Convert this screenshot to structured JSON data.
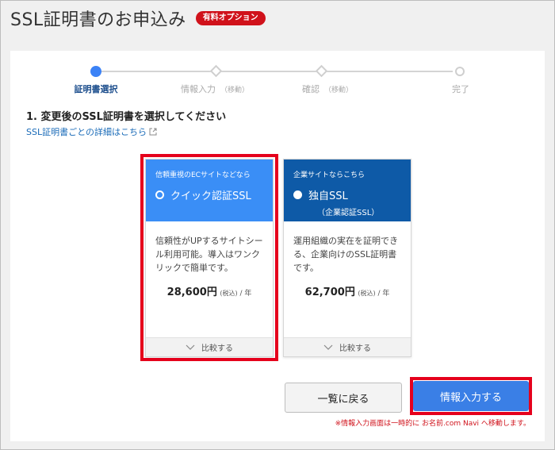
{
  "header": {
    "title": "SSL証明書のお申込み",
    "badge": "有料オプション"
  },
  "stepper": {
    "steps": [
      {
        "label": "証明書選択",
        "sub": ""
      },
      {
        "label": "情報入力",
        "sub": "（移動）"
      },
      {
        "label": "確認",
        "sub": "（移動）"
      },
      {
        "label": "完了",
        "sub": ""
      }
    ]
  },
  "section": {
    "title": "1. 変更後のSSL証明書を選択してください",
    "detail_link": "SSL証明書ごとの詳細はこちら"
  },
  "cards": [
    {
      "tagline": "信頼重視のECサイトなどなら",
      "name": "クイック認証SSL",
      "subname": "",
      "description": "信頼性がUPするサイトシール利用可能。導入はワンクリックで簡単です。",
      "price": "28,600円",
      "tax": "(税込)",
      "per": " / 年",
      "compare": "比較する",
      "selected": false,
      "head_color": "#3a8ef6"
    },
    {
      "tagline": "企業サイトならこちら",
      "name": "独自SSL",
      "subname": "（企業認証SSL）",
      "description": "運用組織の実在を証明できる、企業向けのSSL証明書です。",
      "price": "62,700円",
      "tax": "(税込)",
      "per": " / 年",
      "compare": "比較する",
      "selected": true,
      "head_color": "#0e5aa7"
    }
  ],
  "buttons": {
    "back": "一覧に戻る",
    "next": "情報入力する"
  },
  "note": "※情報入力画面は一時的に お名前.com Navi へ移動します。",
  "colors": {
    "accent": "#3a7fe6",
    "highlight": "#e5001c",
    "badge": "#d0121b"
  }
}
